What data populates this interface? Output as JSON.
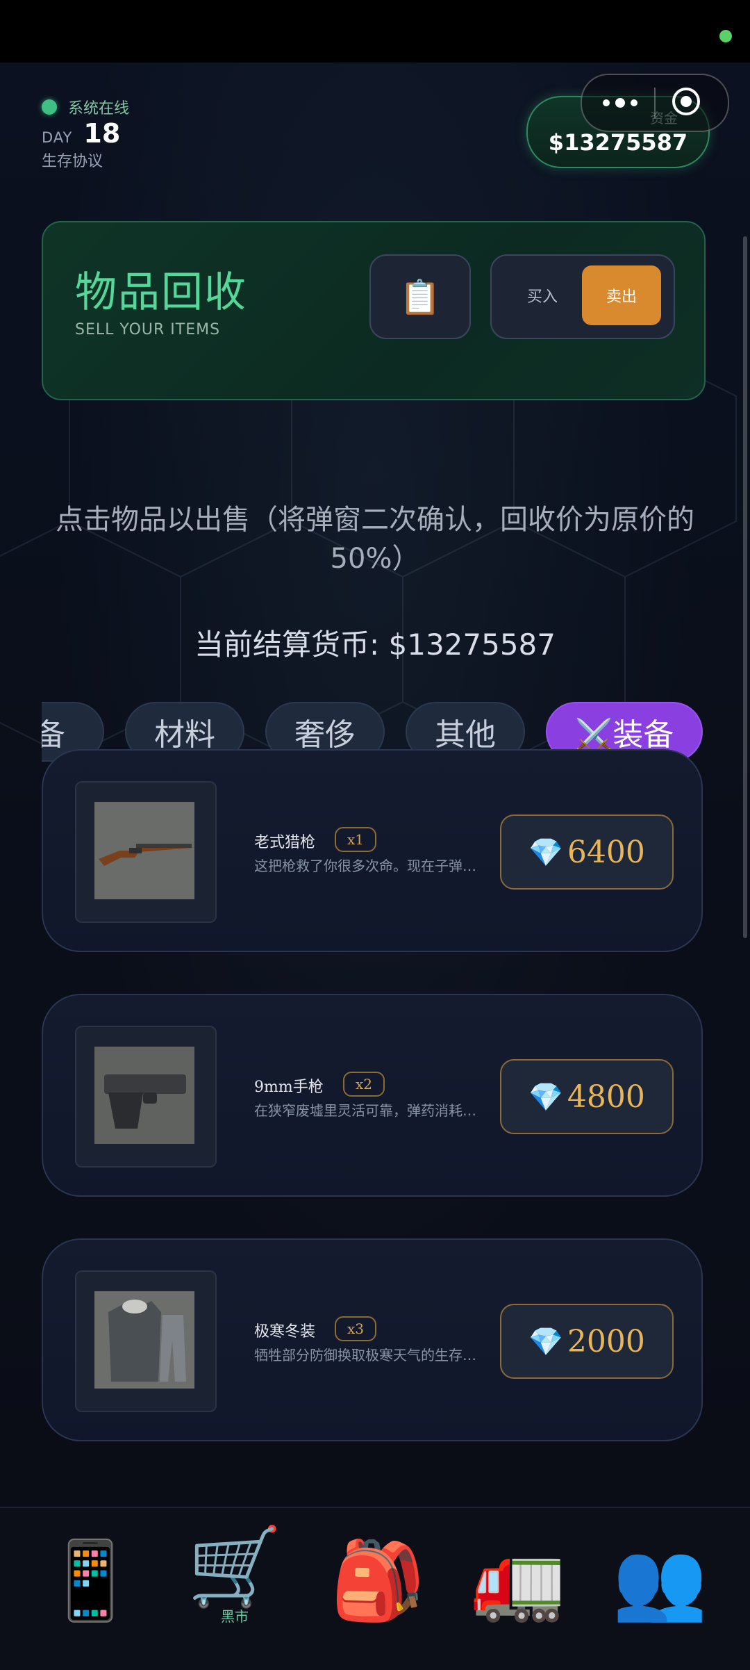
{
  "header": {
    "status_text": "系统在线",
    "day_label": "DAY",
    "day_number": "18",
    "protocol": "生存协议",
    "funds_label": "资金",
    "funds_value": "$13275587"
  },
  "hero": {
    "title": "物品回收",
    "subtitle": "SELL YOUR ITEMS",
    "clipboard_icon": "📋",
    "buy_label": "买入",
    "sell_label": "卖出"
  },
  "hint": "点击物品以出售（将弹窗二次确认，回收价为原价的50%）",
  "currency_line": "当前结算货币: $13275587",
  "tabs": [
    {
      "label": "装备"
    },
    {
      "label": "材料"
    },
    {
      "label": "奢侈"
    },
    {
      "label": "其他"
    },
    {
      "label": "⚔️装备"
    }
  ],
  "items": [
    {
      "name": "老式猎枪",
      "qty": "x1",
      "desc": "这把枪救了你很多次命。现在子弹不多了，但它依旧可靠。",
      "gem": "💎",
      "price": "6400",
      "image": "rifle"
    },
    {
      "name": "9mm手枪",
      "qty": "x2",
      "desc": "在狭窄废墟里灵活可靠，弹药消耗也更低。",
      "gem": "💎",
      "price": "4800",
      "image": "pistol"
    },
    {
      "name": "极寒冬装",
      "qty": "x3",
      "desc": "牺牲部分防御换取极寒天气的生存能力。",
      "gem": "💎",
      "price": "2000",
      "image": "winter-coat"
    }
  ],
  "bottom_nav": [
    {
      "icon": "📱",
      "label": "",
      "name": "phone"
    },
    {
      "icon": "🛒",
      "label": "黑市",
      "name": "black-market"
    },
    {
      "icon": "🎒",
      "label": "",
      "name": "backpack"
    },
    {
      "icon": "🚛",
      "label": "",
      "name": "truck"
    },
    {
      "icon": "👥",
      "label": "",
      "name": "people"
    }
  ],
  "colors": {
    "accent_green": "#55d79a",
    "sell_orange": "#d98a2e",
    "tab_active": "#8a3fe0",
    "price_gold": "#e8b658"
  }
}
